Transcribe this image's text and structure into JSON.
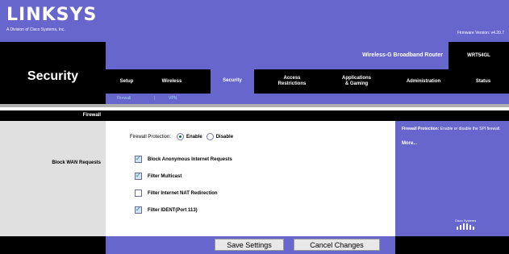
{
  "brand": {
    "logo": "LINKSYS",
    "tagline": "A Division of Cisco Systems, Inc.",
    "firmware": "Firmware Version: v4.20.7"
  },
  "product": {
    "name": "Wireless-G Broadband Router",
    "model": "WRT54GL"
  },
  "section_title": "Security",
  "tabs": [
    {
      "label": "Setup",
      "active": false
    },
    {
      "label": "Wireless",
      "active": false
    },
    {
      "label": "Security",
      "active": true
    },
    {
      "label": "Access\nRestrictions",
      "active": false
    },
    {
      "label": "Applications\n& Gaming",
      "active": false
    },
    {
      "label": "Administration",
      "active": false
    },
    {
      "label": "Status",
      "active": false
    }
  ],
  "subnav": {
    "items": [
      "Firewall",
      "|",
      "VPN"
    ]
  },
  "left": {
    "head": "Firewall",
    "label": "Block WAN Requests"
  },
  "firewall": {
    "label": "Firewall Protection:",
    "enable_label": "Enable",
    "disable_label": "Disable",
    "selected": "Enable"
  },
  "options": [
    {
      "label": "Block Anonymous Internet Requests",
      "checked": true
    },
    {
      "label": "Filter Multicast",
      "checked": true
    },
    {
      "label": "Filter Internet NAT Redirection",
      "checked": false
    },
    {
      "label": "Filter IDENT(Port 113)",
      "checked": true
    }
  ],
  "help": {
    "title": "Firewall Protection:",
    "text": "Enable or disable the SPI firewall.",
    "more": "More..."
  },
  "cisco": "Cisco Systems",
  "buttons": {
    "save": "Save Settings",
    "cancel": "Cancel Changes"
  },
  "colors": {
    "accent": "#6666cc",
    "dark": "#000000"
  }
}
